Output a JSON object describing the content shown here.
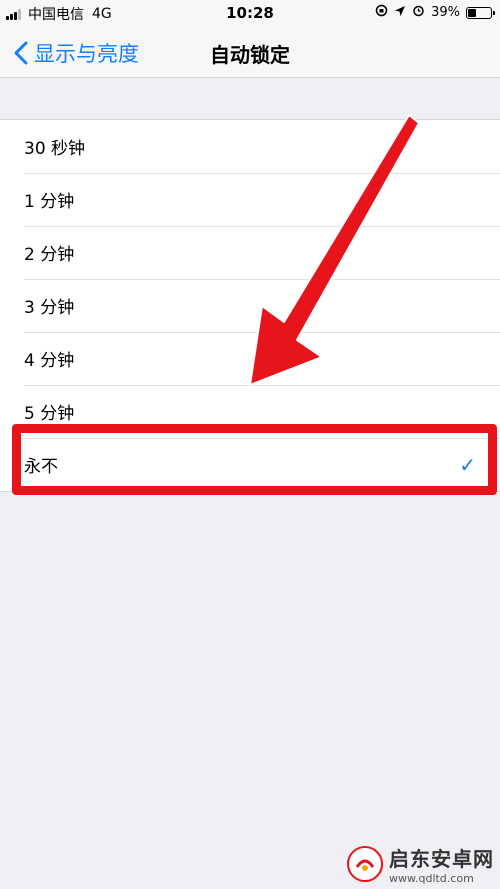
{
  "status_bar": {
    "carrier": "中国电信",
    "network": "4G",
    "time": "10:28",
    "battery": "39%",
    "battery_level": 0.39
  },
  "nav": {
    "back_label": "显示与亮度",
    "title": "自动锁定"
  },
  "options": [
    {
      "label": "30 秒钟",
      "selected": false
    },
    {
      "label": "1 分钟",
      "selected": false
    },
    {
      "label": "2 分钟",
      "selected": false
    },
    {
      "label": "3 分钟",
      "selected": false
    },
    {
      "label": "4 分钟",
      "selected": false
    },
    {
      "label": "5 分钟",
      "selected": false
    },
    {
      "label": "永不",
      "selected": true
    }
  ],
  "checkmark": "✓",
  "colors": {
    "accent": "#157efb",
    "annotation": "#e8141c",
    "background": "#efeff4"
  },
  "watermark": {
    "title": "启东安卓网",
    "url": "www.qdltd.com"
  }
}
